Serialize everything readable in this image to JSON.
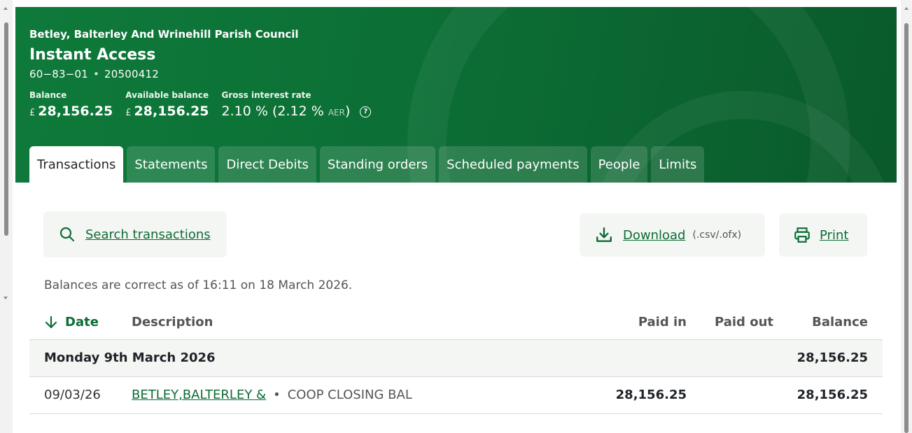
{
  "account": {
    "organisation": "Betley, Balterley And Wrinehill Parish Council",
    "name": "Instant Access",
    "sort_code": "60−83−01",
    "separator": "•",
    "account_number": "20500412",
    "balance_label": "Balance",
    "balance_currency": "£",
    "balance_value": "28,156.25",
    "available_label": "Available balance",
    "available_currency": "£",
    "available_value": "28,156.25",
    "interest_label": "Gross interest rate",
    "interest_value": "2.10 % (2.12 %",
    "interest_aer": "AER",
    "interest_close": ")"
  },
  "tabs": [
    {
      "label": "Transactions"
    },
    {
      "label": "Statements"
    },
    {
      "label": "Direct Debits"
    },
    {
      "label": "Standing orders"
    },
    {
      "label": "Scheduled payments"
    },
    {
      "label": "People"
    },
    {
      "label": "Limits"
    }
  ],
  "active_tab": "Transactions",
  "toolbar": {
    "search_label": "Search transactions",
    "download_label": "Download",
    "download_formats": "(.csv/.ofx)",
    "print_label": "Print"
  },
  "note": "Balances are correct as of 16:11 on 18 March 2026.",
  "table": {
    "headers": {
      "date": "Date",
      "description": "Description",
      "paid_in": "Paid in",
      "paid_out": "Paid out",
      "balance": "Balance"
    },
    "groups": [
      {
        "title": "Monday 9th March 2026",
        "balance": "28,156.25",
        "rows": [
          {
            "date": "09/03/26",
            "payee": "BETLEY,BALTERLEY &",
            "separator": "•",
            "reference": "COOP CLOSING BAL",
            "paid_in": "28,156.25",
            "paid_out": "",
            "balance": "28,156.25"
          }
        ]
      }
    ]
  },
  "colors": {
    "brand_green": "#0c6c34",
    "header_bg": "#0e7a3a",
    "row_shade": "#f4f6f4"
  }
}
